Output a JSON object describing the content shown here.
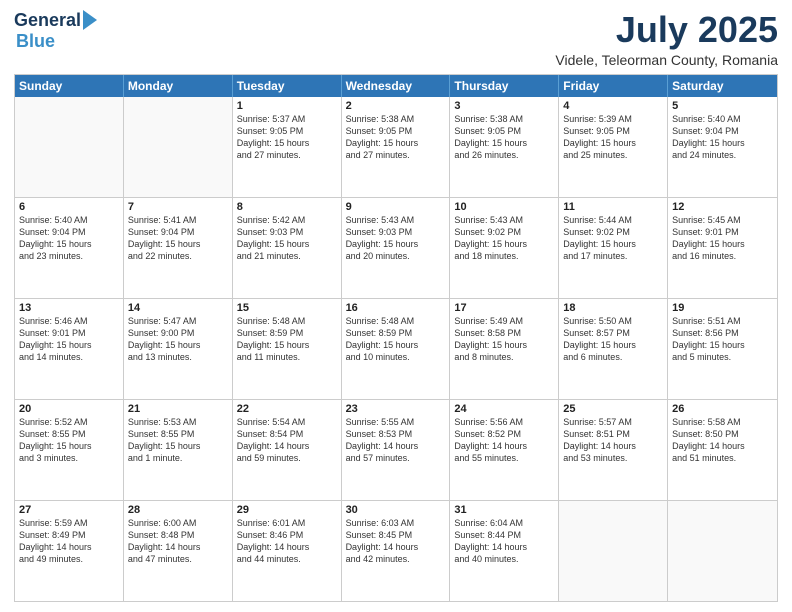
{
  "logo": {
    "general": "General",
    "blue": "Blue"
  },
  "header": {
    "month": "July 2025",
    "location": "Videle, Teleorman County, Romania"
  },
  "weekdays": [
    "Sunday",
    "Monday",
    "Tuesday",
    "Wednesday",
    "Thursday",
    "Friday",
    "Saturday"
  ],
  "rows": [
    [
      {
        "day": "",
        "empty": true
      },
      {
        "day": "",
        "empty": true
      },
      {
        "day": "1",
        "line1": "Sunrise: 5:37 AM",
        "line2": "Sunset: 9:05 PM",
        "line3": "Daylight: 15 hours",
        "line4": "and 27 minutes."
      },
      {
        "day": "2",
        "line1": "Sunrise: 5:38 AM",
        "line2": "Sunset: 9:05 PM",
        "line3": "Daylight: 15 hours",
        "line4": "and 27 minutes."
      },
      {
        "day": "3",
        "line1": "Sunrise: 5:38 AM",
        "line2": "Sunset: 9:05 PM",
        "line3": "Daylight: 15 hours",
        "line4": "and 26 minutes."
      },
      {
        "day": "4",
        "line1": "Sunrise: 5:39 AM",
        "line2": "Sunset: 9:05 PM",
        "line3": "Daylight: 15 hours",
        "line4": "and 25 minutes."
      },
      {
        "day": "5",
        "line1": "Sunrise: 5:40 AM",
        "line2": "Sunset: 9:04 PM",
        "line3": "Daylight: 15 hours",
        "line4": "and 24 minutes."
      }
    ],
    [
      {
        "day": "6",
        "line1": "Sunrise: 5:40 AM",
        "line2": "Sunset: 9:04 PM",
        "line3": "Daylight: 15 hours",
        "line4": "and 23 minutes."
      },
      {
        "day": "7",
        "line1": "Sunrise: 5:41 AM",
        "line2": "Sunset: 9:04 PM",
        "line3": "Daylight: 15 hours",
        "line4": "and 22 minutes."
      },
      {
        "day": "8",
        "line1": "Sunrise: 5:42 AM",
        "line2": "Sunset: 9:03 PM",
        "line3": "Daylight: 15 hours",
        "line4": "and 21 minutes."
      },
      {
        "day": "9",
        "line1": "Sunrise: 5:43 AM",
        "line2": "Sunset: 9:03 PM",
        "line3": "Daylight: 15 hours",
        "line4": "and 20 minutes."
      },
      {
        "day": "10",
        "line1": "Sunrise: 5:43 AM",
        "line2": "Sunset: 9:02 PM",
        "line3": "Daylight: 15 hours",
        "line4": "and 18 minutes."
      },
      {
        "day": "11",
        "line1": "Sunrise: 5:44 AM",
        "line2": "Sunset: 9:02 PM",
        "line3": "Daylight: 15 hours",
        "line4": "and 17 minutes."
      },
      {
        "day": "12",
        "line1": "Sunrise: 5:45 AM",
        "line2": "Sunset: 9:01 PM",
        "line3": "Daylight: 15 hours",
        "line4": "and 16 minutes."
      }
    ],
    [
      {
        "day": "13",
        "line1": "Sunrise: 5:46 AM",
        "line2": "Sunset: 9:01 PM",
        "line3": "Daylight: 15 hours",
        "line4": "and 14 minutes."
      },
      {
        "day": "14",
        "line1": "Sunrise: 5:47 AM",
        "line2": "Sunset: 9:00 PM",
        "line3": "Daylight: 15 hours",
        "line4": "and 13 minutes."
      },
      {
        "day": "15",
        "line1": "Sunrise: 5:48 AM",
        "line2": "Sunset: 8:59 PM",
        "line3": "Daylight: 15 hours",
        "line4": "and 11 minutes."
      },
      {
        "day": "16",
        "line1": "Sunrise: 5:48 AM",
        "line2": "Sunset: 8:59 PM",
        "line3": "Daylight: 15 hours",
        "line4": "and 10 minutes."
      },
      {
        "day": "17",
        "line1": "Sunrise: 5:49 AM",
        "line2": "Sunset: 8:58 PM",
        "line3": "Daylight: 15 hours",
        "line4": "and 8 minutes."
      },
      {
        "day": "18",
        "line1": "Sunrise: 5:50 AM",
        "line2": "Sunset: 8:57 PM",
        "line3": "Daylight: 15 hours",
        "line4": "and 6 minutes."
      },
      {
        "day": "19",
        "line1": "Sunrise: 5:51 AM",
        "line2": "Sunset: 8:56 PM",
        "line3": "Daylight: 15 hours",
        "line4": "and 5 minutes."
      }
    ],
    [
      {
        "day": "20",
        "line1": "Sunrise: 5:52 AM",
        "line2": "Sunset: 8:55 PM",
        "line3": "Daylight: 15 hours",
        "line4": "and 3 minutes."
      },
      {
        "day": "21",
        "line1": "Sunrise: 5:53 AM",
        "line2": "Sunset: 8:55 PM",
        "line3": "Daylight: 15 hours",
        "line4": "and 1 minute."
      },
      {
        "day": "22",
        "line1": "Sunrise: 5:54 AM",
        "line2": "Sunset: 8:54 PM",
        "line3": "Daylight: 14 hours",
        "line4": "and 59 minutes."
      },
      {
        "day": "23",
        "line1": "Sunrise: 5:55 AM",
        "line2": "Sunset: 8:53 PM",
        "line3": "Daylight: 14 hours",
        "line4": "and 57 minutes."
      },
      {
        "day": "24",
        "line1": "Sunrise: 5:56 AM",
        "line2": "Sunset: 8:52 PM",
        "line3": "Daylight: 14 hours",
        "line4": "and 55 minutes."
      },
      {
        "day": "25",
        "line1": "Sunrise: 5:57 AM",
        "line2": "Sunset: 8:51 PM",
        "line3": "Daylight: 14 hours",
        "line4": "and 53 minutes."
      },
      {
        "day": "26",
        "line1": "Sunrise: 5:58 AM",
        "line2": "Sunset: 8:50 PM",
        "line3": "Daylight: 14 hours",
        "line4": "and 51 minutes."
      }
    ],
    [
      {
        "day": "27",
        "line1": "Sunrise: 5:59 AM",
        "line2": "Sunset: 8:49 PM",
        "line3": "Daylight: 14 hours",
        "line4": "and 49 minutes."
      },
      {
        "day": "28",
        "line1": "Sunrise: 6:00 AM",
        "line2": "Sunset: 8:48 PM",
        "line3": "Daylight: 14 hours",
        "line4": "and 47 minutes."
      },
      {
        "day": "29",
        "line1": "Sunrise: 6:01 AM",
        "line2": "Sunset: 8:46 PM",
        "line3": "Daylight: 14 hours",
        "line4": "and 44 minutes."
      },
      {
        "day": "30",
        "line1": "Sunrise: 6:03 AM",
        "line2": "Sunset: 8:45 PM",
        "line3": "Daylight: 14 hours",
        "line4": "and 42 minutes."
      },
      {
        "day": "31",
        "line1": "Sunrise: 6:04 AM",
        "line2": "Sunset: 8:44 PM",
        "line3": "Daylight: 14 hours",
        "line4": "and 40 minutes."
      },
      {
        "day": "",
        "empty": true
      },
      {
        "day": "",
        "empty": true
      }
    ]
  ]
}
